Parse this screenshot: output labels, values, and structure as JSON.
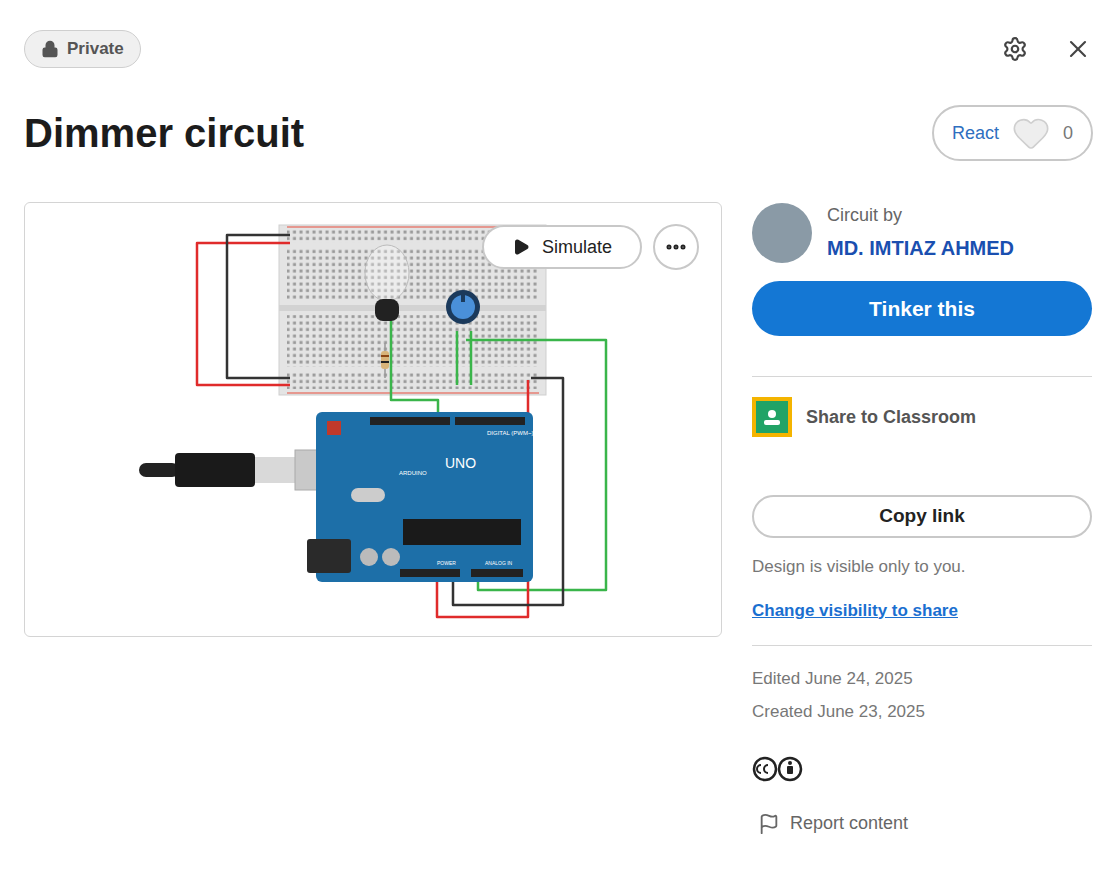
{
  "badge": {
    "label": "Private"
  },
  "title": "Dimmer circuit",
  "react": {
    "label": "React",
    "count": "0",
    "reacted": false
  },
  "preview": {
    "simulate": "Simulate",
    "board_labels": {
      "brand": "ARDUINO",
      "model": "UNO",
      "digital": "DIGITAL (PWM~)",
      "power": "POWER",
      "analog": "ANALOG IN"
    }
  },
  "author": {
    "caption": "Circuit by",
    "name": "MD. IMTIAZ AHMED"
  },
  "primary_button": "Tinker this",
  "share": "Share to Classroom",
  "copy_button": "Copy link",
  "visibility": {
    "note": "Design is visible only to you.",
    "link": "Change visibility to share"
  },
  "dates": [
    "Edited June 24, 2025",
    "Created June 23, 2025"
  ],
  "report": "Report content"
}
